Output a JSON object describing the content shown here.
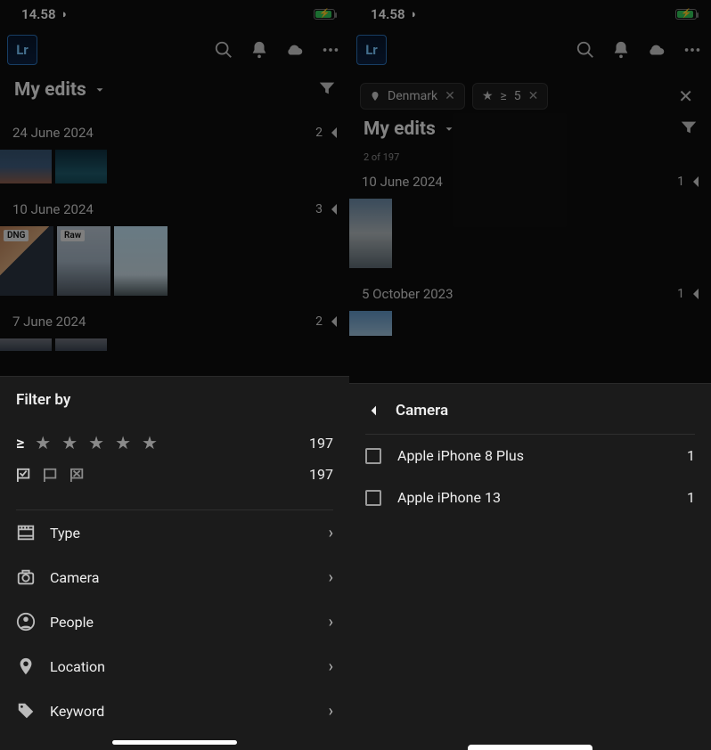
{
  "status": {
    "time": "14.58",
    "battery_charging": true
  },
  "left": {
    "title": "My edits",
    "groups": [
      {
        "date": "24 June 2024",
        "count": "2"
      },
      {
        "date": "10 June 2024",
        "count": "3"
      },
      {
        "date": "7 June 2024",
        "count": "2"
      }
    ],
    "badges": {
      "dng": "DNG",
      "raw": "Raw"
    },
    "sheet": {
      "title": "Filter by",
      "rating_count": "197",
      "flag_count": "197",
      "rows": {
        "type": "Type",
        "camera": "Camera",
        "people": "People",
        "location": "Location",
        "keyword": "Keyword"
      }
    }
  },
  "right": {
    "chips": {
      "location": "Denmark",
      "rating_op": "≥",
      "rating_val": "5"
    },
    "title": "My edits",
    "subcount": "2 of 197",
    "groups": [
      {
        "date": "10 June 2024",
        "count": "1"
      },
      {
        "date": "5 October 2023",
        "count": "1"
      }
    ],
    "sheet": {
      "title": "Camera",
      "items": [
        {
          "label": "Apple iPhone 8 Plus",
          "count": "1"
        },
        {
          "label": "Apple iPhone 13",
          "count": "1"
        }
      ]
    }
  }
}
